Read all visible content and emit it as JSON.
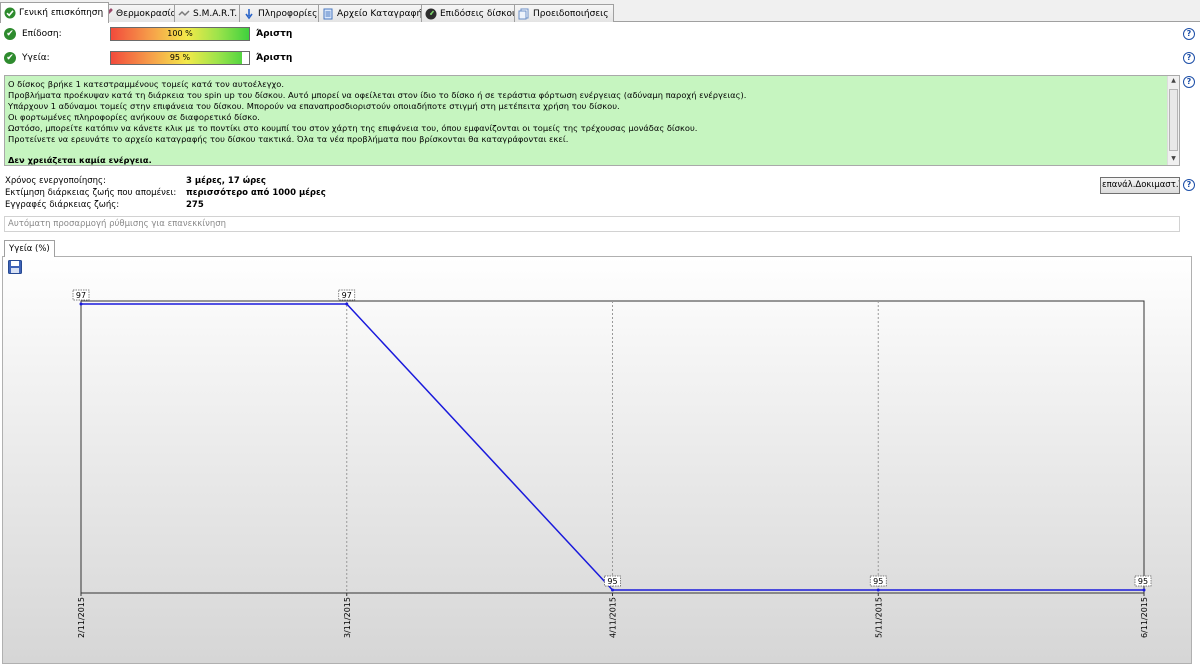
{
  "tabs": [
    {
      "label": "Γενική επισκόπηση",
      "icon": "check-icon"
    },
    {
      "label": "Θερμοκρασία",
      "icon": "thermometer-icon"
    },
    {
      "label": "S.M.A.R.T.",
      "icon": "smart-icon"
    },
    {
      "label": "Πληροφορίες",
      "icon": "info-icon"
    },
    {
      "label": "Αρχείο Καταγραφής",
      "icon": "log-icon"
    },
    {
      "label": "Επιδόσεις δίσκου",
      "icon": "disk-performance-icon"
    },
    {
      "label": "Προειδοποιήσεις",
      "icon": "warnings-icon"
    }
  ],
  "performance": {
    "label": "Επίδοση:",
    "value": "100 %",
    "percent": 100,
    "status": "Άριστη"
  },
  "health": {
    "label": "Υγεία:",
    "value": "95 %",
    "percent": 95,
    "status": "Άριστη"
  },
  "message": {
    "lines": [
      "Ο δίσκος βρήκε 1 κατεστραμμένους τομείς κατά τον αυτοέλεγχο.",
      "Προβλήματα προέκυψαν κατά τη διάρκεια του spin up του δίσκου. Αυτό μπορεί να οφείλεται στον ίδιο το δίσκο ή σε τεράστια φόρτωση ενέργειας (αδύναμη παροχή ενέργειας).",
      "Υπάρχουν 1 αδύναμοι τομείς στην επιφάνεια του δίσκου. Μπορούν να επαναπροσδιοριστούν οποιαδήποτε στιγμή στη μετέπειτα χρήση του δίσκου.",
      "Οι φορτωμένες πληροφορίες ανήκουν σε διαφορετικό δίσκο.",
      "Ωστόσο, μπορείτε κατόπιν να κάνετε κλικ με το ποντίκι στο κουμπί του  στον  χάρτη της επιφάνεια του, όπου εμφανίζονται οι τομείς της τρέχουσας μονάδας δίσκου.",
      "Προτείνετε να ερευνάτε το αρχείο καταγραφής του δίσκου τακτικά. Όλα τα νέα προβλήματα που βρίσκονται θα καταγράφονται εκεί."
    ],
    "conclusion": "Δεν χρειάζεται καμία ενέργεια."
  },
  "stats": [
    {
      "label": "Χρόνος ενεργοποίησης:",
      "value": "3 μέρες, 17 ώρες"
    },
    {
      "label": "Εκτίμηση διάρκειας ζωής που απομένει:",
      "value": "περισσότερο από 1000 μέρες"
    },
    {
      "label": "Εγγραφές διάρκειας ζωής:",
      "value": "275"
    }
  ],
  "retest_button": "επανάλ.Δοκιμαστ.Τεστ",
  "auto_adjust_placeholder": "Αυτόματη προσαρμογή ρύθμισης για επανεκκίνηση",
  "chart_tab": "Υγεία (%)",
  "colors": {
    "accent_line": "#1a1adc",
    "panel_green": "#c6f5c0",
    "check_green": "#2e8b2e",
    "help_blue": "#1d4fa8"
  },
  "chart_data": {
    "type": "line",
    "title": "",
    "xlabel": "",
    "ylabel": "",
    "x": [
      "2/11/2015",
      "3/11/2015",
      "4/11/2015",
      "5/11/2015",
      "6/11/2015"
    ],
    "series": [
      {
        "values": [
          97,
          97,
          95,
          95,
          95
        ]
      }
    ],
    "ylim": [
      95,
      97
    ],
    "grid": true,
    "legend": "none"
  }
}
